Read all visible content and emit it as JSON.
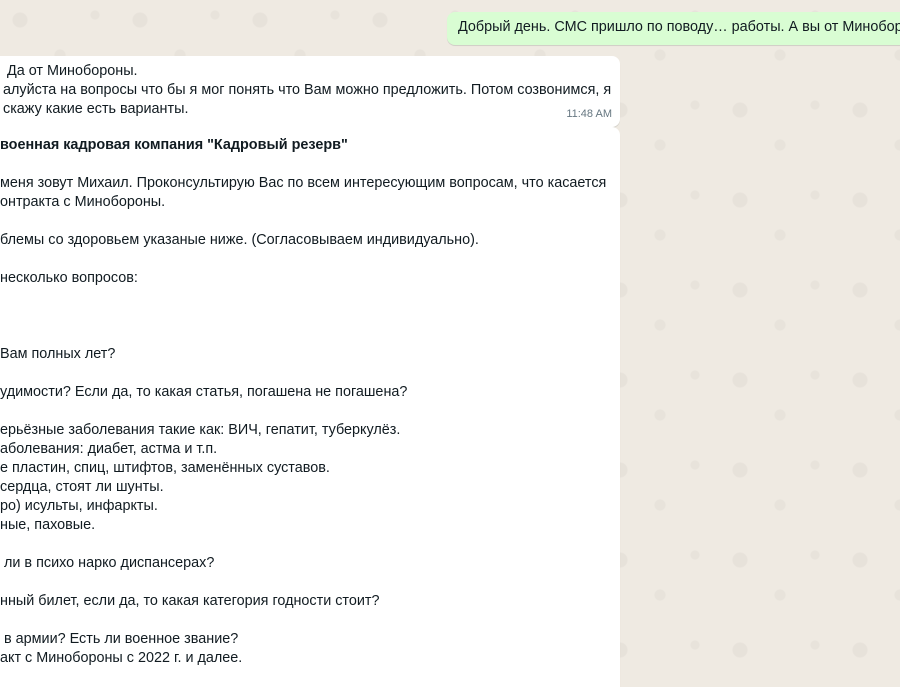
{
  "chat": {
    "outgoing": {
      "text": "Добрый день. СМС пришло по поводу… работы. А вы от Минобороны?"
    },
    "incoming_1": {
      "lines": [
        " Да от Минобороны.",
        "алуйста на вопросы что бы я мог понять что Вам можно предложить. Потом созвонимся, я",
        "скажу какие есть варианты."
      ],
      "time": "11:48 AM"
    },
    "incoming_2": {
      "lines": [
        "военная кадровая компания \"Кадровый резерв\"",
        "",
        "меня зовут Михаил. Проконсультирую Вас по всем интересующим вопросам, что касается",
        "онтракта с Минобороны.",
        "",
        "блемы со здоровьем указаные ниже. (Согласовываем индивидуально).",
        "",
        "несколько вопросов:",
        "",
        "",
        "",
        "Вам полных лет?",
        "",
        "удимости? Если да, то какая статья, погашена не погашена?",
        "",
        "ерьёзные заболевания такие как: ВИЧ, гепатит, туберкулёз.",
        "аболевания: диабет, астма и т.п.",
        "е пластин, спиц, штифтов, заменённых суставов.",
        "сердца, стоят ли шунты.",
        "ро) исульты, инфаркты.",
        "ные, паховые.",
        "",
        " ли в психо нарко диспансерах?",
        "",
        "нный билет, если да, то какая категория годности стоит?",
        "",
        " в армии? Есть ли военное звание?",
        "акт с Минобороны с 2022 г. и далее."
      ]
    }
  }
}
